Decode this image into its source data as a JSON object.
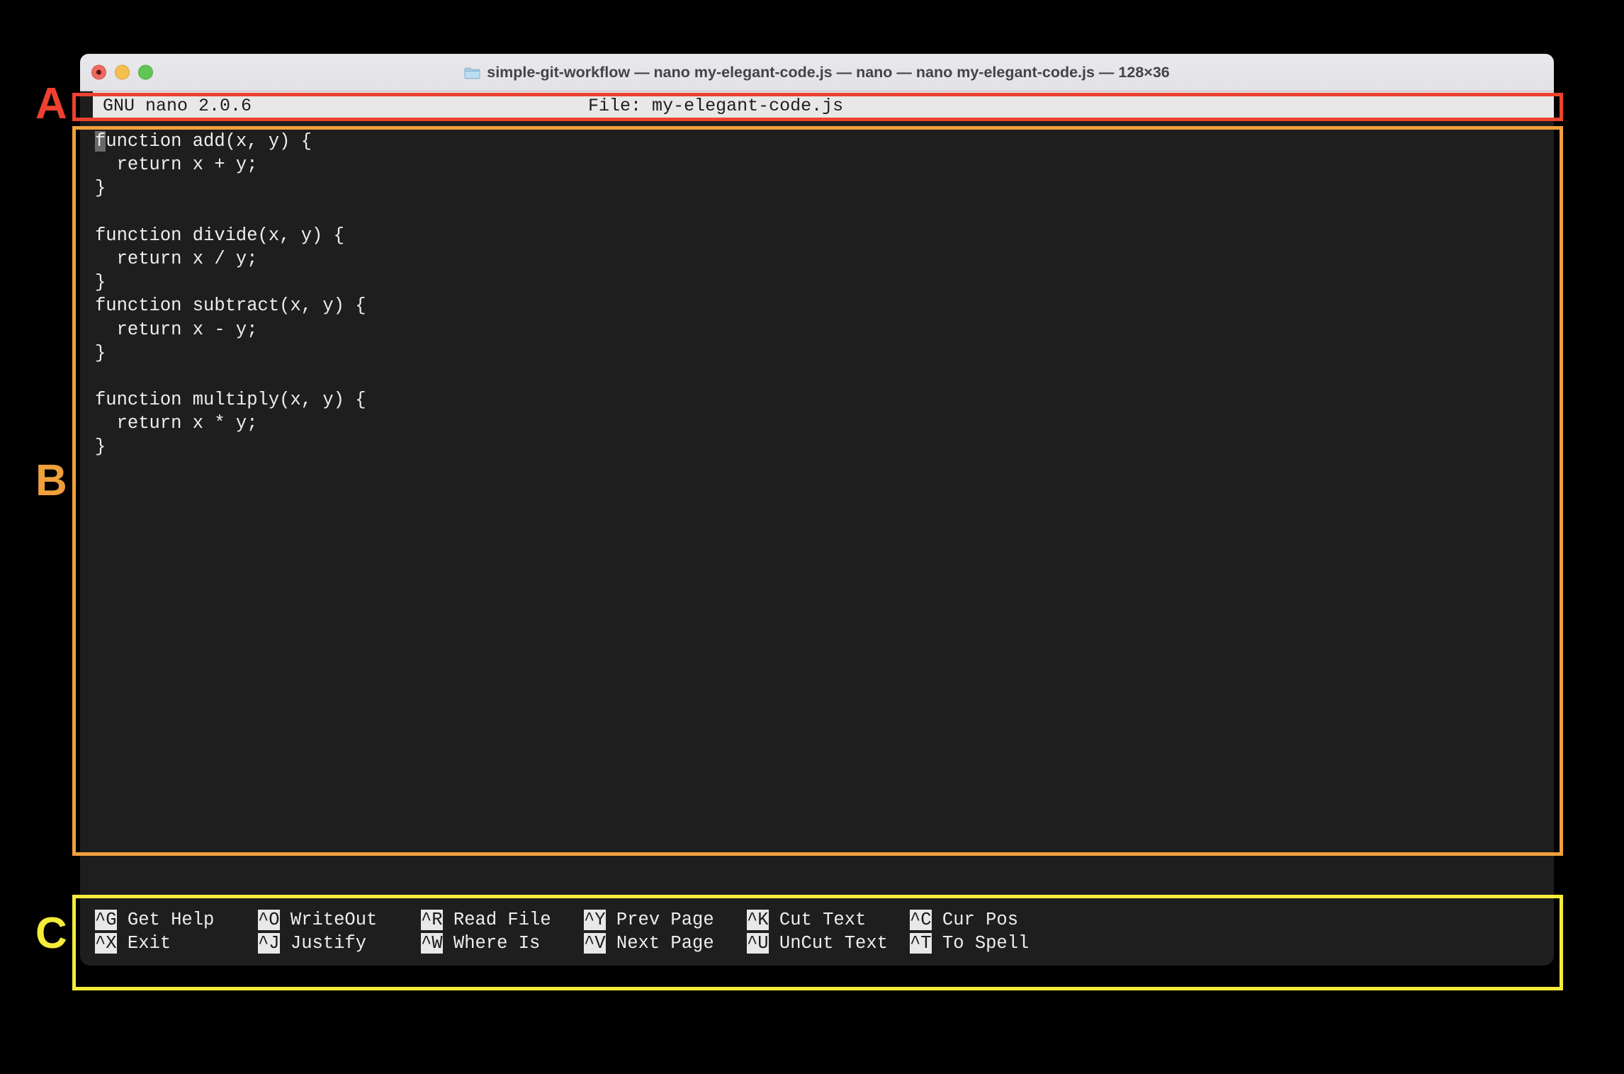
{
  "window": {
    "title": "simple-git-workflow — nano my-elegant-code.js — nano — nano my-elegant-code.js — 128×36",
    "folder_icon": "folder-icon",
    "traffic_lights": [
      "close",
      "minimize",
      "maximize"
    ]
  },
  "nano": {
    "version_label": "GNU nano 2.0.6",
    "file_label": "File: my-elegant-code.js",
    "code_lines": [
      "function add(x, y) {",
      "  return x + y;",
      "}",
      "",
      "function divide(x, y) {",
      "  return x / y;",
      "}",
      "function subtract(x, y) {",
      "  return x - y;",
      "}",
      "",
      "function multiply(x, y) {",
      "  return x * y;",
      "}"
    ],
    "cursor": {
      "line": 0,
      "column": 0,
      "char": "f"
    },
    "shortcuts": [
      [
        {
          "key": "^G",
          "label": "Get Help"
        },
        {
          "key": "^X",
          "label": "Exit"
        }
      ],
      [
        {
          "key": "^O",
          "label": "WriteOut"
        },
        {
          "key": "^J",
          "label": "Justify"
        }
      ],
      [
        {
          "key": "^R",
          "label": "Read File"
        },
        {
          "key": "^W",
          "label": "Where Is"
        }
      ],
      [
        {
          "key": "^Y",
          "label": "Prev Page"
        },
        {
          "key": "^V",
          "label": "Next Page"
        }
      ],
      [
        {
          "key": "^K",
          "label": "Cut Text"
        },
        {
          "key": "^U",
          "label": "UnCut Text"
        }
      ],
      [
        {
          "key": "^C",
          "label": "Cur Pos"
        },
        {
          "key": "^T",
          "label": "To Spell"
        }
      ]
    ]
  },
  "annotations": [
    {
      "letter": "A",
      "color": "#ef4130",
      "target": "nano-header-bar"
    },
    {
      "letter": "B",
      "color": "#f0a03c",
      "target": "code-editing-area"
    },
    {
      "letter": "C",
      "color": "#f5ec3a",
      "target": "shortcut-help-bar"
    }
  ]
}
